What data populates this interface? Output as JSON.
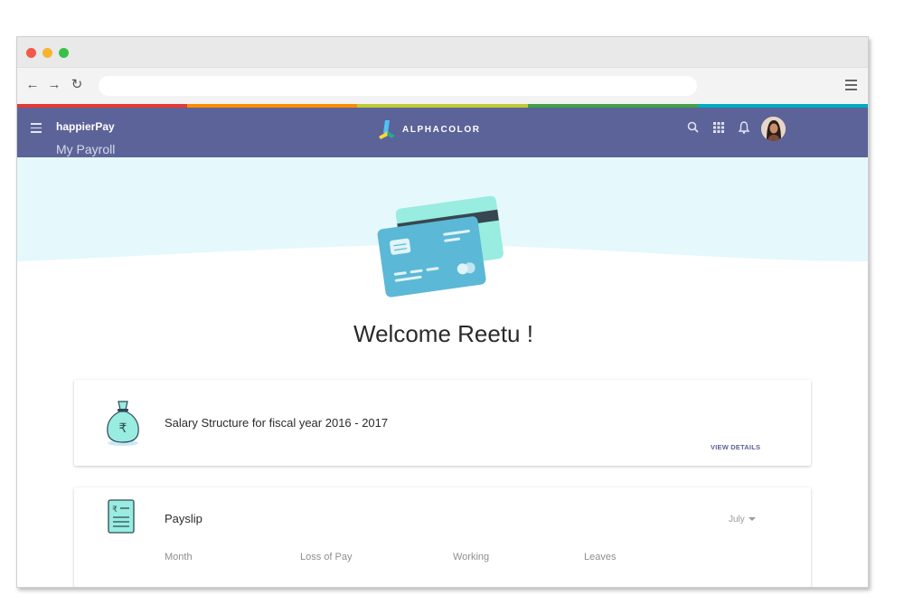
{
  "browser": {
    "address_value": "",
    "nav_icons": [
      "back-arrow-icon",
      "forward-arrow-icon",
      "reload-icon"
    ],
    "rainbow_colors": [
      "#e53935",
      "#fb8c00",
      "#c0ca33",
      "#43a047",
      "#00acc1"
    ]
  },
  "appbar": {
    "app_name": "happierPay",
    "section": "My Payroll",
    "brand_name": "ALPHACOLOR",
    "background": "#5c6398",
    "icons": [
      "search-icon",
      "apps-grid-icon",
      "bell-icon"
    ]
  },
  "hero": {
    "welcome": "Welcome Reetu !",
    "background": "#e5f8fb"
  },
  "salary_card": {
    "title": "Salary Structure for fiscal year 2016 - 2017",
    "action": "VIEW DETAILS",
    "icon": "money-bag-rupee-icon"
  },
  "payslip_card": {
    "title": "Payslip",
    "selected_month": "July",
    "icon": "payslip-document-icon",
    "columns": [
      "Month",
      "Loss of Pay",
      "Working",
      "Leaves"
    ]
  }
}
